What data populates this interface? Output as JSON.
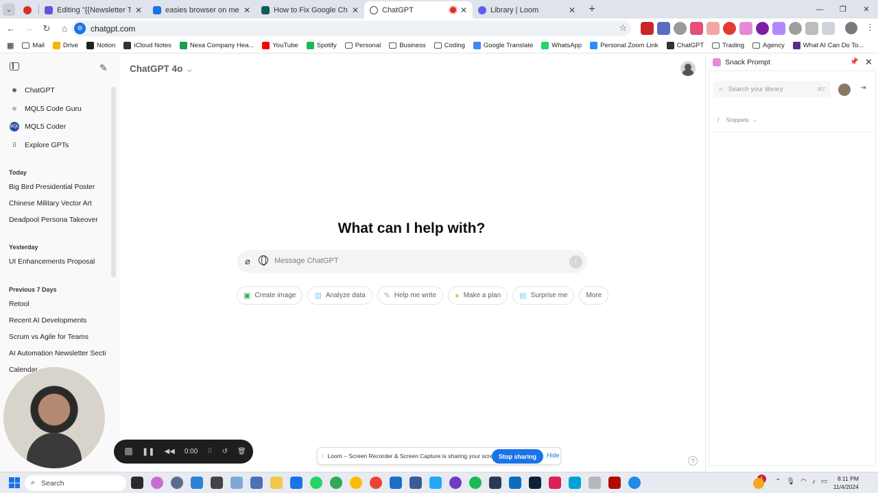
{
  "browser": {
    "tabs": [
      {
        "title": "Editing \"{{Newsletter Title}} ◀",
        "favicon_color": "#6b4fd8",
        "active": false
      },
      {
        "title": "easies browser on memory (ho",
        "favicon_color": "#1a73e8",
        "active": false
      },
      {
        "title": "How to Fix Google Chrome Hi",
        "favicon_color": "#0b5c5c",
        "active": false
      },
      {
        "title": "ChatGPT",
        "favicon_color": "#444444",
        "active": true
      },
      {
        "title": "Library | Loom",
        "favicon_color": "#625df5",
        "active": false
      }
    ],
    "url": "chatgpt.com",
    "bookmarks": [
      {
        "label": "Mail",
        "icon": "folder-icon"
      },
      {
        "label": "Drive",
        "icon": "drive-icon",
        "color": "#f4b400"
      },
      {
        "label": "Notion",
        "icon": "notion-icon",
        "color": "#222222"
      },
      {
        "label": "iCloud Notes",
        "icon": "apple-icon",
        "color": "#333333"
      },
      {
        "label": "Nexa Company Hea...",
        "icon": "nexa-icon",
        "color": "#1e9e4a"
      },
      {
        "label": "YouTube",
        "icon": "youtube-icon",
        "color": "#ff0000"
      },
      {
        "label": "Spotify",
        "icon": "spotify-icon",
        "color": "#1db954"
      },
      {
        "label": "Personal",
        "icon": "folder-icon"
      },
      {
        "label": "Business",
        "icon": "folder-icon"
      },
      {
        "label": "Coding",
        "icon": "folder-icon"
      },
      {
        "label": "Google Translate",
        "icon": "translate-icon",
        "color": "#4285f4"
      },
      {
        "label": "WhatsApp",
        "icon": "whatsapp-icon",
        "color": "#25d366"
      },
      {
        "label": "Personal Zoom Link",
        "icon": "zoom-icon",
        "color": "#2d8cff"
      },
      {
        "label": "ChatGPT",
        "icon": "chatgpt-icon",
        "color": "#333333"
      },
      {
        "label": "Trading",
        "icon": "folder-icon"
      },
      {
        "label": "Agency",
        "icon": "folder-icon"
      },
      {
        "label": "What AI Can Do To...",
        "icon": "ai-icon",
        "color": "#5b2c83"
      }
    ]
  },
  "sidebar": {
    "gpts": [
      {
        "label": "ChatGPT",
        "icon": "openai-icon"
      },
      {
        "label": "MQL5 Code Guru",
        "icon": "code-guru-icon"
      },
      {
        "label": "MQL5 Coder",
        "icon": "mql5-icon"
      },
      {
        "label": "Explore GPTs",
        "icon": "grid-icon"
      }
    ],
    "sections": [
      {
        "title": "Today",
        "items": [
          "Big Bird Presidential Poster",
          "Chinese Military Vector Art",
          "Deadpool Persona Takeover"
        ]
      },
      {
        "title": "Yesterday",
        "items": [
          "UI Enhancements Proposal"
        ]
      },
      {
        "title": "Previous 7 Days",
        "items": [
          "Retool",
          "Recent AI Developments",
          "Scrum vs Agile for Teams",
          "AI Automation Newsletter Secti",
          "Calendar"
        ]
      }
    ]
  },
  "main": {
    "model": "ChatGPT 4o",
    "heading": "What can I help with?",
    "composer_placeholder": "Message ChatGPT",
    "chips": [
      {
        "label": "Create image",
        "icon": "image-icon",
        "color": "#35ae47"
      },
      {
        "label": "Analyze data",
        "icon": "chart-icon",
        "color": "#76d0eb"
      },
      {
        "label": "Help me write",
        "icon": "pen-icon",
        "color": "#cb8bd0"
      },
      {
        "label": "Make a plan",
        "icon": "bulb-icon",
        "color": "#e2c541"
      },
      {
        "label": "Surprise me",
        "icon": "gift-icon",
        "color": "#76d0eb"
      },
      {
        "label": "More",
        "icon": "",
        "color": ""
      }
    ],
    "help": "?"
  },
  "panel": {
    "title": "Snack Prompt",
    "search_placeholder": "Search your library",
    "shortcut": "⌘F",
    "snippets_label": "Snippets"
  },
  "loom": {
    "timer": "0:00",
    "share_message": "Loom – Screen Recorder & Screen Capture is sharing your screen.",
    "stop_label": "Stop sharing",
    "hide_label": "Hide"
  },
  "taskbar": {
    "search_label": "Search",
    "time": "8:11 PM",
    "date": "11/4/2024",
    "badge": "1"
  }
}
